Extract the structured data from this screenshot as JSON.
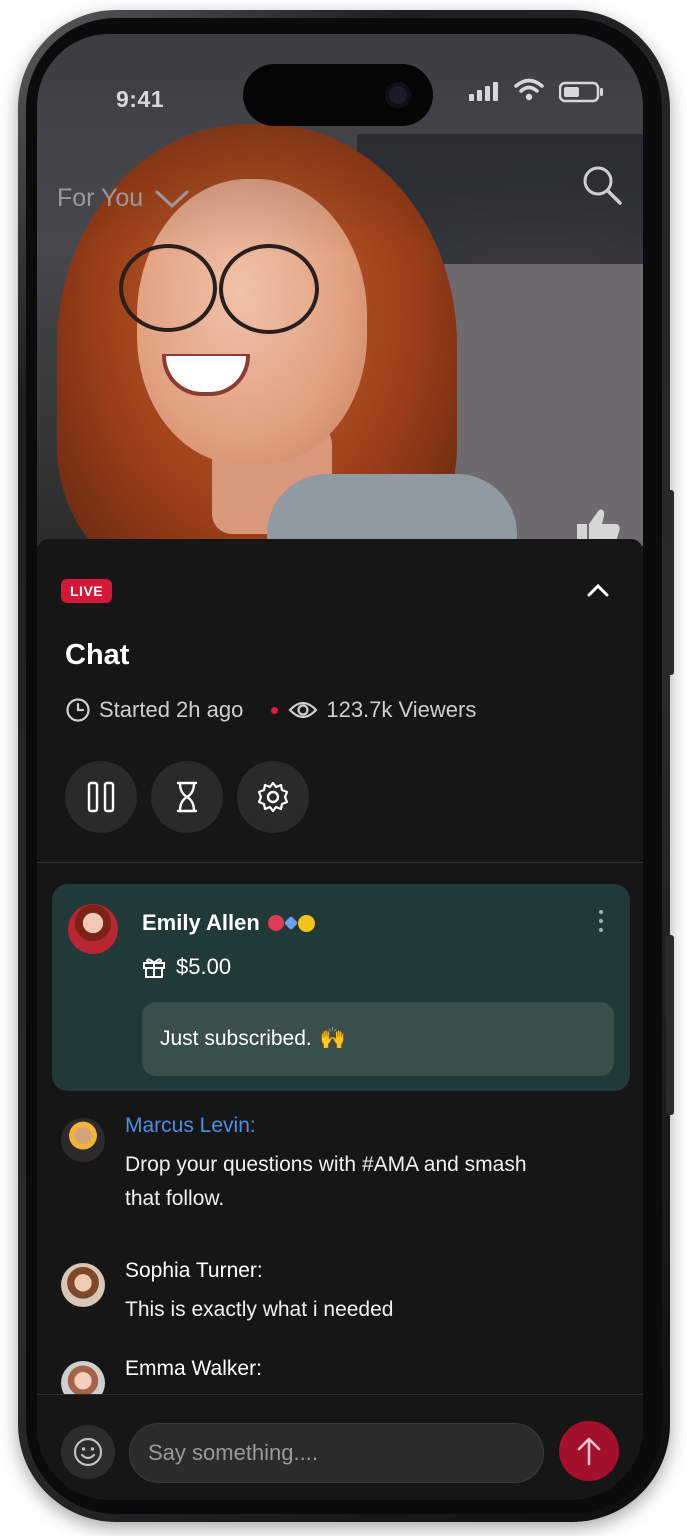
{
  "status_bar": {
    "time": "9:41"
  },
  "header": {
    "feed_label": "For You"
  },
  "stream": {
    "live_badge": "LIVE",
    "title": "Chat",
    "started": "Started 2h ago",
    "viewers": "123.7k Viewers"
  },
  "controls": {
    "pause_icon": "pause-icon",
    "timer_icon": "hourglass-icon",
    "settings_icon": "gear-icon"
  },
  "highlight": {
    "name": "Emily Allen",
    "amount": "$5.00",
    "message": "Just subscribed.",
    "emoji": "🙌"
  },
  "messages": [
    {
      "name": "Marcus Levin:",
      "text": "Drop your questions with #AMA and smash that follow.",
      "name_color": "#4b8ee4"
    },
    {
      "name": "Sophia Turner:",
      "text": "This is exactly what i needed"
    },
    {
      "name": "Emma Walker:",
      "text": ""
    }
  ],
  "input": {
    "placeholder": "Say something...."
  },
  "colors": {
    "accent": "#d5173a",
    "highlight_bg": "#213a39",
    "send_bg": "#a3112c"
  }
}
